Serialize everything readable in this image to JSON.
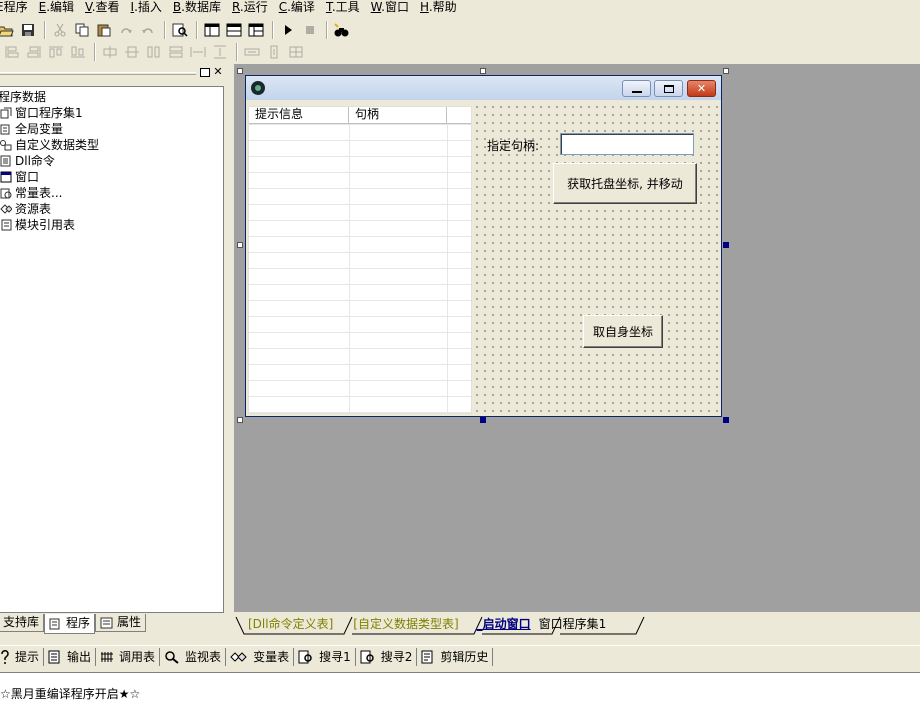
{
  "menubar": {
    "items": [
      {
        "key": "",
        "label": "程序"
      },
      {
        "key": "E",
        "label": ".编辑"
      },
      {
        "key": "V",
        "label": ".查看"
      },
      {
        "key": "I",
        "label": ".插入"
      },
      {
        "key": "B",
        "label": ".数据库"
      },
      {
        "key": "R",
        "label": ".运行"
      },
      {
        "key": "C",
        "label": ".编译"
      },
      {
        "key": "T",
        "label": ".工具"
      },
      {
        "key": "W",
        "label": ".窗口"
      },
      {
        "key": "H",
        "label": ".帮助"
      }
    ]
  },
  "tree": {
    "root": "程序数据",
    "items": [
      {
        "label": "窗口程序集1",
        "icon": "assembly-icon"
      },
      {
        "label": "全局变量",
        "icon": "variable-icon"
      },
      {
        "label": "自定义数据类型",
        "icon": "datatype-icon"
      },
      {
        "label": "Dll命令",
        "icon": "dll-icon"
      },
      {
        "label": "窗口",
        "icon": "window-icon"
      },
      {
        "label": "常量表...",
        "icon": "constant-icon"
      },
      {
        "label": "资源表",
        "icon": "resource-icon"
      },
      {
        "label": "模块引用表",
        "icon": "module-icon"
      }
    ]
  },
  "left_tabs": {
    "support": "支持库",
    "program": "程序",
    "property": "属性"
  },
  "form": {
    "listview": {
      "columns": [
        "提示信息",
        "句柄"
      ]
    },
    "handle_label": "指定句柄:",
    "handle_input": "",
    "btn_tray": "获取托盘坐标, 并移动",
    "btn_self": "取自身坐标"
  },
  "doc_tabs": [
    {
      "label": "[Dll命令定义表]",
      "state": "normal"
    },
    {
      "label": "[自定义数据类型表]",
      "state": "normal"
    },
    {
      "label": "_启动窗口",
      "state": "active"
    },
    {
      "label": "窗口程序集1",
      "state": "black"
    }
  ],
  "output_tabs": [
    {
      "label": "提示",
      "icon": "hint-icon"
    },
    {
      "label": "输出",
      "icon": "output-icon"
    },
    {
      "label": "调用表",
      "icon": "calltable-icon"
    },
    {
      "label": "监视表",
      "icon": "watch-icon"
    },
    {
      "label": "变量表",
      "icon": "vartable-icon"
    },
    {
      "label": "搜寻1",
      "icon": "search1-icon"
    },
    {
      "label": "搜寻2",
      "icon": "search2-icon"
    },
    {
      "label": "剪辑历史",
      "icon": "clipboard-history-icon"
    }
  ],
  "status_text": "☆黑月重编译程序开启★☆",
  "colors": {
    "design_bg": "#a0a0a0",
    "active_tab": "#000080",
    "inactive_tab": "#808000",
    "close_button": "#c23b17"
  }
}
